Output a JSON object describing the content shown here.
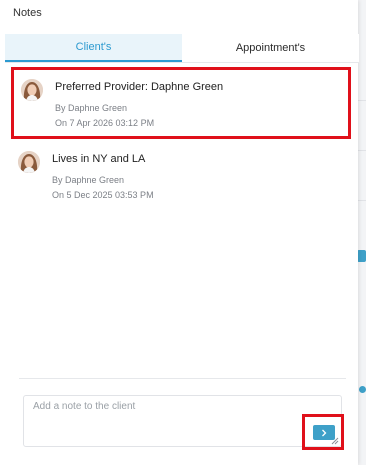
{
  "panel": {
    "title": "Notes",
    "tabs": [
      {
        "label": "Client's",
        "active": true
      },
      {
        "label": "Appointment's",
        "active": false
      }
    ]
  },
  "notes": [
    {
      "title": "Preferred Provider: Daphne Green",
      "by": "By Daphne Green",
      "date": "On 7 Apr 2026 03:12 PM",
      "avatar": "avatar"
    },
    {
      "title": "Lives in NY and LA",
      "by": "By Daphne Green",
      "date": "On 5 Dec 2025 03:53 PM",
      "avatar": "avatar"
    }
  ],
  "composer": {
    "placeholder": "Add a note to the client",
    "value": "",
    "send_icon": "chevron-right-icon"
  },
  "colors": {
    "accent": "#2c9ad0",
    "button": "#3ea0c8",
    "highlight": "#e0101a",
    "tab_active_bg": "#e9f4fa"
  }
}
